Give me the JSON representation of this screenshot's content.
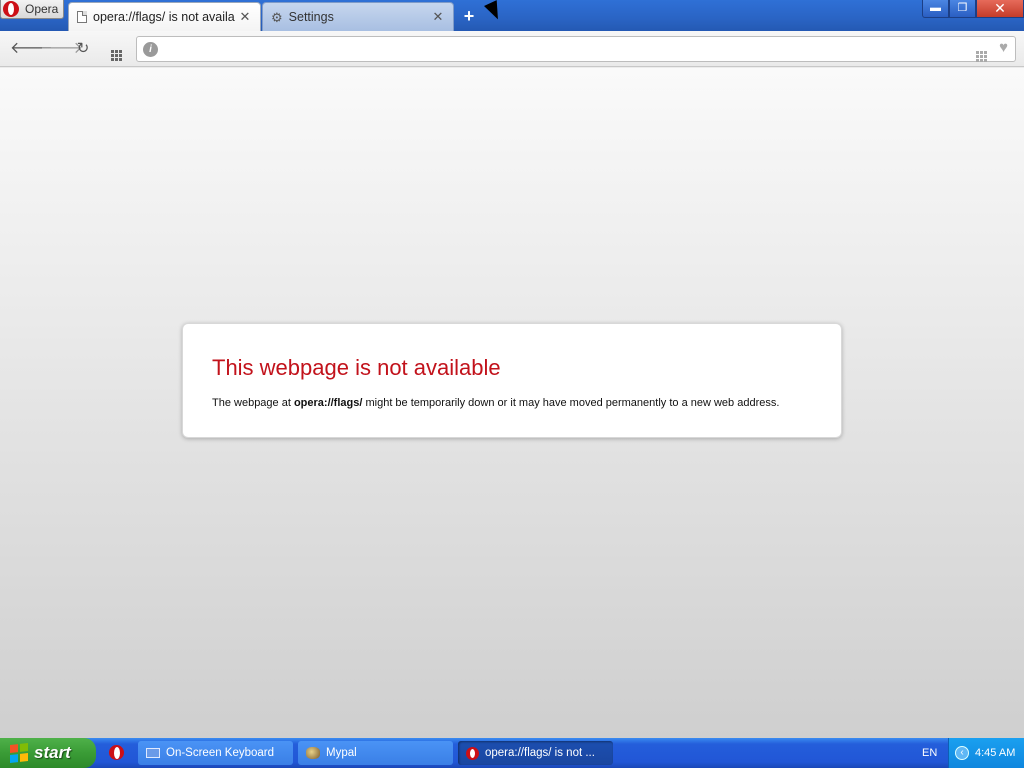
{
  "browser": {
    "menu_label": "Opera",
    "tabs": [
      {
        "label": "opera://flags/ is not availa",
        "icon": "page-icon",
        "active": true
      },
      {
        "label": "Settings",
        "icon": "gear-icon",
        "active": false
      }
    ],
    "new_tab_symbol": "+",
    "window_controls": {
      "minimize": "▬",
      "maximize": "❐",
      "close": "✕"
    },
    "address_bar": {
      "value": "",
      "placeholder": ""
    }
  },
  "toolbar": {
    "back_icon": "🡐",
    "forward_icon": "🡒",
    "reload_icon": "↻"
  },
  "error_page": {
    "title": "This webpage is not available",
    "message_prefix": "The webpage at ",
    "url": "opera://flags/",
    "message_suffix": " might be temporarily down or it may have moved permanently to a new web address."
  },
  "taskbar": {
    "start_label": "start",
    "tasks": [
      {
        "label": "On-Screen Keyboard",
        "icon": "keyboard-icon"
      },
      {
        "label": "Mypal",
        "icon": "mypal-icon"
      },
      {
        "label": "opera://flags/ is not ...",
        "icon": "opera-icon",
        "active": true
      }
    ],
    "tray": {
      "language": "EN",
      "clock": "4:45 AM"
    }
  },
  "colors": {
    "title_bar": "#2a64c4",
    "error_title": "#c2121b",
    "taskbar": "#245edb",
    "start_button": "#3a9c36"
  }
}
